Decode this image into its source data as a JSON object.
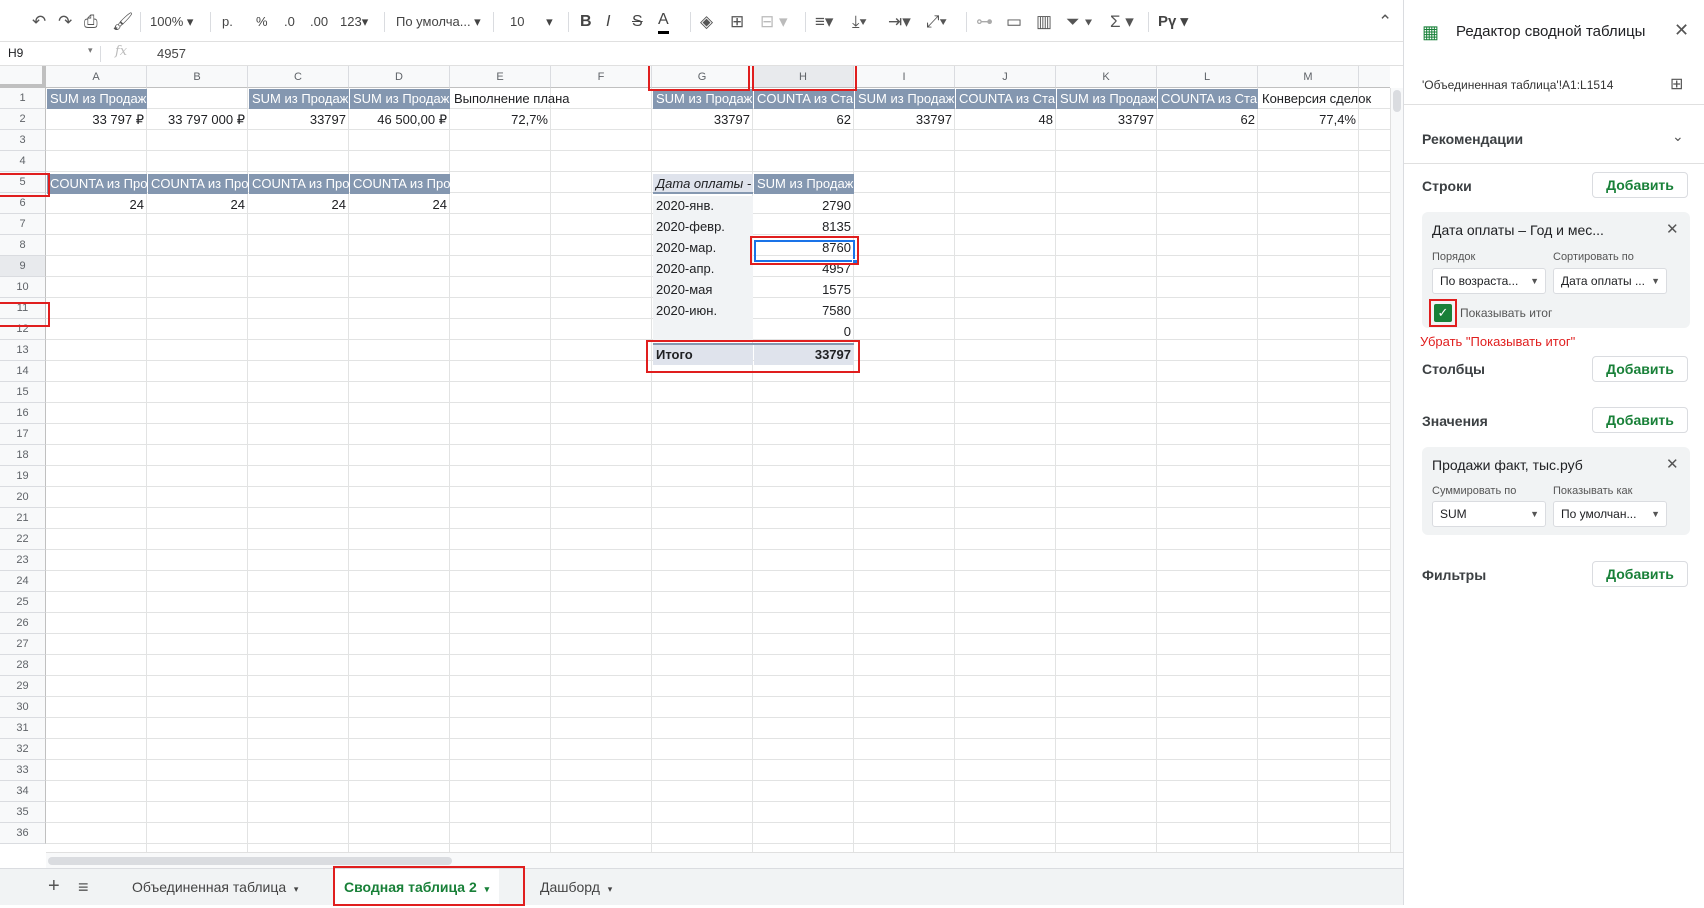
{
  "toolbar": {
    "zoom": "100%",
    "currency": "р.",
    "percent": "%",
    "dec_less": ".0",
    "dec_more": ".00",
    "format_more": "123",
    "font": "По умолча...",
    "font_size": "10",
    "bold": "B",
    "italic": "I",
    "strike": "S",
    "text_color": "A",
    "script": "Рү"
  },
  "formula_bar": {
    "cell_ref": "H9",
    "fx": "fx",
    "value": "4957"
  },
  "columns": [
    "A",
    "B",
    "C",
    "D",
    "E",
    "F",
    "G",
    "H",
    "I",
    "J",
    "K",
    "L",
    "M"
  ],
  "rows": [
    "1",
    "2",
    "3",
    "4",
    "5",
    "6",
    "7",
    "8",
    "9",
    "10",
    "11",
    "12",
    "13",
    "14",
    "15",
    "16",
    "17",
    "18",
    "19",
    "20",
    "21",
    "22",
    "23",
    "24",
    "25",
    "26",
    "27",
    "28",
    "29",
    "30",
    "31",
    "32",
    "33",
    "34",
    "35",
    "36"
  ],
  "cells": {
    "a1": "SUM из Продаж",
    "c1": "SUM из Продаж",
    "d1": "SUM из Продаж",
    "e1": "Выполнение плана",
    "g1": "SUM из Продаж",
    "h1": "COUNTA из Ста",
    "i1": "SUM из Продаж",
    "j1": "COUNTA из Ста",
    "k1": "SUM из Продаж",
    "l1": "COUNTA из Ста",
    "m1": "Конверсия сделок",
    "a2": "33 797 ₽",
    "b2": "33 797 000 ₽",
    "c2": "33797",
    "d2": "46 500,00 ₽",
    "e2": "72,7%",
    "g2": "33797",
    "h2": "62",
    "i2": "33797",
    "j2": "48",
    "k2": "33797",
    "l2": "62",
    "m2": "77,4%",
    "a5": "COUNTA из Про",
    "b5": "COUNTA из Про",
    "c5": "COUNTA из Про",
    "d5": "COUNTA из Про",
    "a6": "24",
    "b6": "24",
    "c6": "24",
    "d6": "24"
  },
  "pivot": {
    "header_date": "Дата оплаты -",
    "header_sum": "SUM из Продаж",
    "rows": [
      {
        "label": "2020-янв.",
        "value": "2790"
      },
      {
        "label": "2020-февр.",
        "value": "8135"
      },
      {
        "label": "2020-мар.",
        "value": "8760"
      },
      {
        "label": "2020-апр.",
        "value": "4957"
      },
      {
        "label": "2020-мая",
        "value": "1575"
      },
      {
        "label": "2020-июн.",
        "value": "7580"
      },
      {
        "label": "",
        "value": "0"
      }
    ],
    "total_label": "Итого",
    "total_value": "33797"
  },
  "sheet_tabs": {
    "tab1": "Объединенная таблица",
    "tab2": "Сводная таблица 2",
    "tab3": "Дашборд"
  },
  "panel": {
    "title": "Редактор сводной таблицы",
    "range": "'Объединенная таблица'!A1:L1514",
    "recommendations": "Рекомендации",
    "rows_label": "Строки",
    "add": "Добавить",
    "row_field": "Дата оплаты – Год и мес...",
    "order_label": "Порядок",
    "order_value": "По возраста...",
    "sort_label": "Сортировать по",
    "sort_value": "Дата оплаты ...",
    "show_total": "Показывать итог",
    "annotation": "Убрать \"Показывать итог\"",
    "columns_label": "Столбцы",
    "values_label": "Значения",
    "value_field": "Продажи факт, тыс.руб",
    "summarize_label": "Суммировать по",
    "summarize_value": "SUM",
    "show_as_label": "Показывать как",
    "show_as_value": "По умолчан...",
    "filters_label": "Фильтры"
  },
  "colors": {
    "header_fill": "#8497b0",
    "accent_green": "#188038",
    "annotation_red": "#e01e1e"
  }
}
